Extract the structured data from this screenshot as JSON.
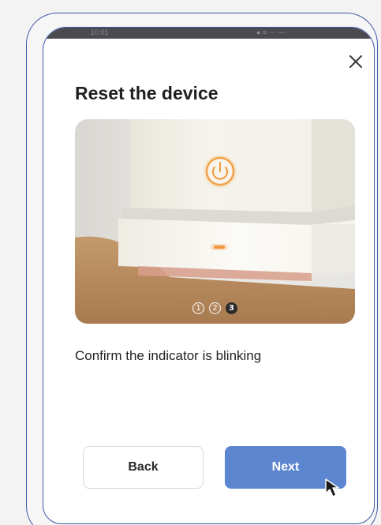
{
  "status_bar": {
    "time": "10:01",
    "right": "● ≡ ··· —"
  },
  "dialog": {
    "title": "Reset the device",
    "close_icon": "close-icon",
    "instruction": "Confirm the indicator is blinking"
  },
  "carousel": {
    "steps": [
      "1",
      "2",
      "3"
    ],
    "active_step": 3
  },
  "buttons": {
    "back_label": "Back",
    "next_label": "Next"
  },
  "colors": {
    "frame_outline": "#3f56a8",
    "primary": "#5c86cf",
    "power_ring": "#f0a24a",
    "led": "#f08a2a"
  }
}
